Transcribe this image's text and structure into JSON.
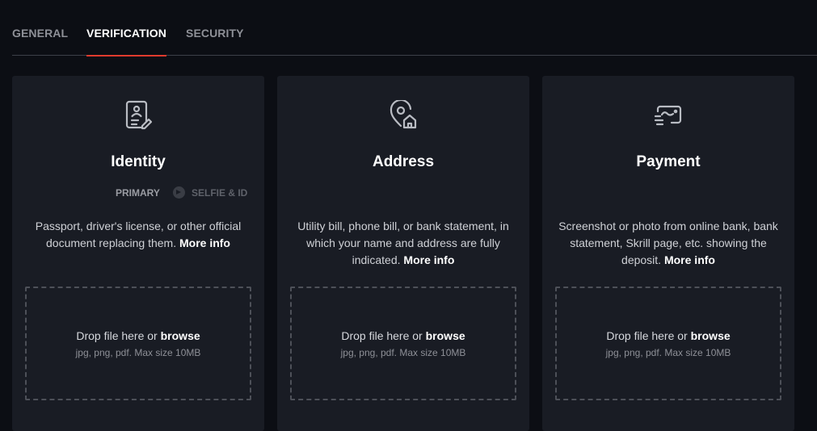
{
  "tabs": [
    {
      "label": "GENERAL",
      "active": false
    },
    {
      "label": "VERIFICATION",
      "active": true
    },
    {
      "label": "SECURITY",
      "active": false
    }
  ],
  "colors": {
    "accent": "#e13b2e",
    "card_bg": "#191c24",
    "page_bg": "#0c0e14"
  },
  "cards": [
    {
      "icon": "id-document-icon",
      "title": "Identity",
      "steps": {
        "primary": "PRIMARY",
        "selfie": "SELFIE & ID"
      },
      "description": "Passport, driver's license, or other official document replacing them.",
      "more_info": "More info",
      "drop_text": "Drop file here or",
      "browse": "browse",
      "hint": "jpg, png, pdf. Max size 10MB"
    },
    {
      "icon": "location-home-icon",
      "title": "Address",
      "description": "Utility bill, phone bill, or bank statement, in which your name and address are fully indicated.",
      "more_info": "More info",
      "drop_text": "Drop file here or",
      "browse": "browse",
      "hint": "jpg, png, pdf. Max size 10MB"
    },
    {
      "icon": "payment-card-icon",
      "title": "Payment",
      "description": "Screenshot or photo from online bank, bank statement, Skrill page, etc. showing the deposit.",
      "more_info": "More info",
      "drop_text": "Drop file here or",
      "browse": "browse",
      "hint": "jpg, png, pdf. Max size 10MB"
    }
  ]
}
